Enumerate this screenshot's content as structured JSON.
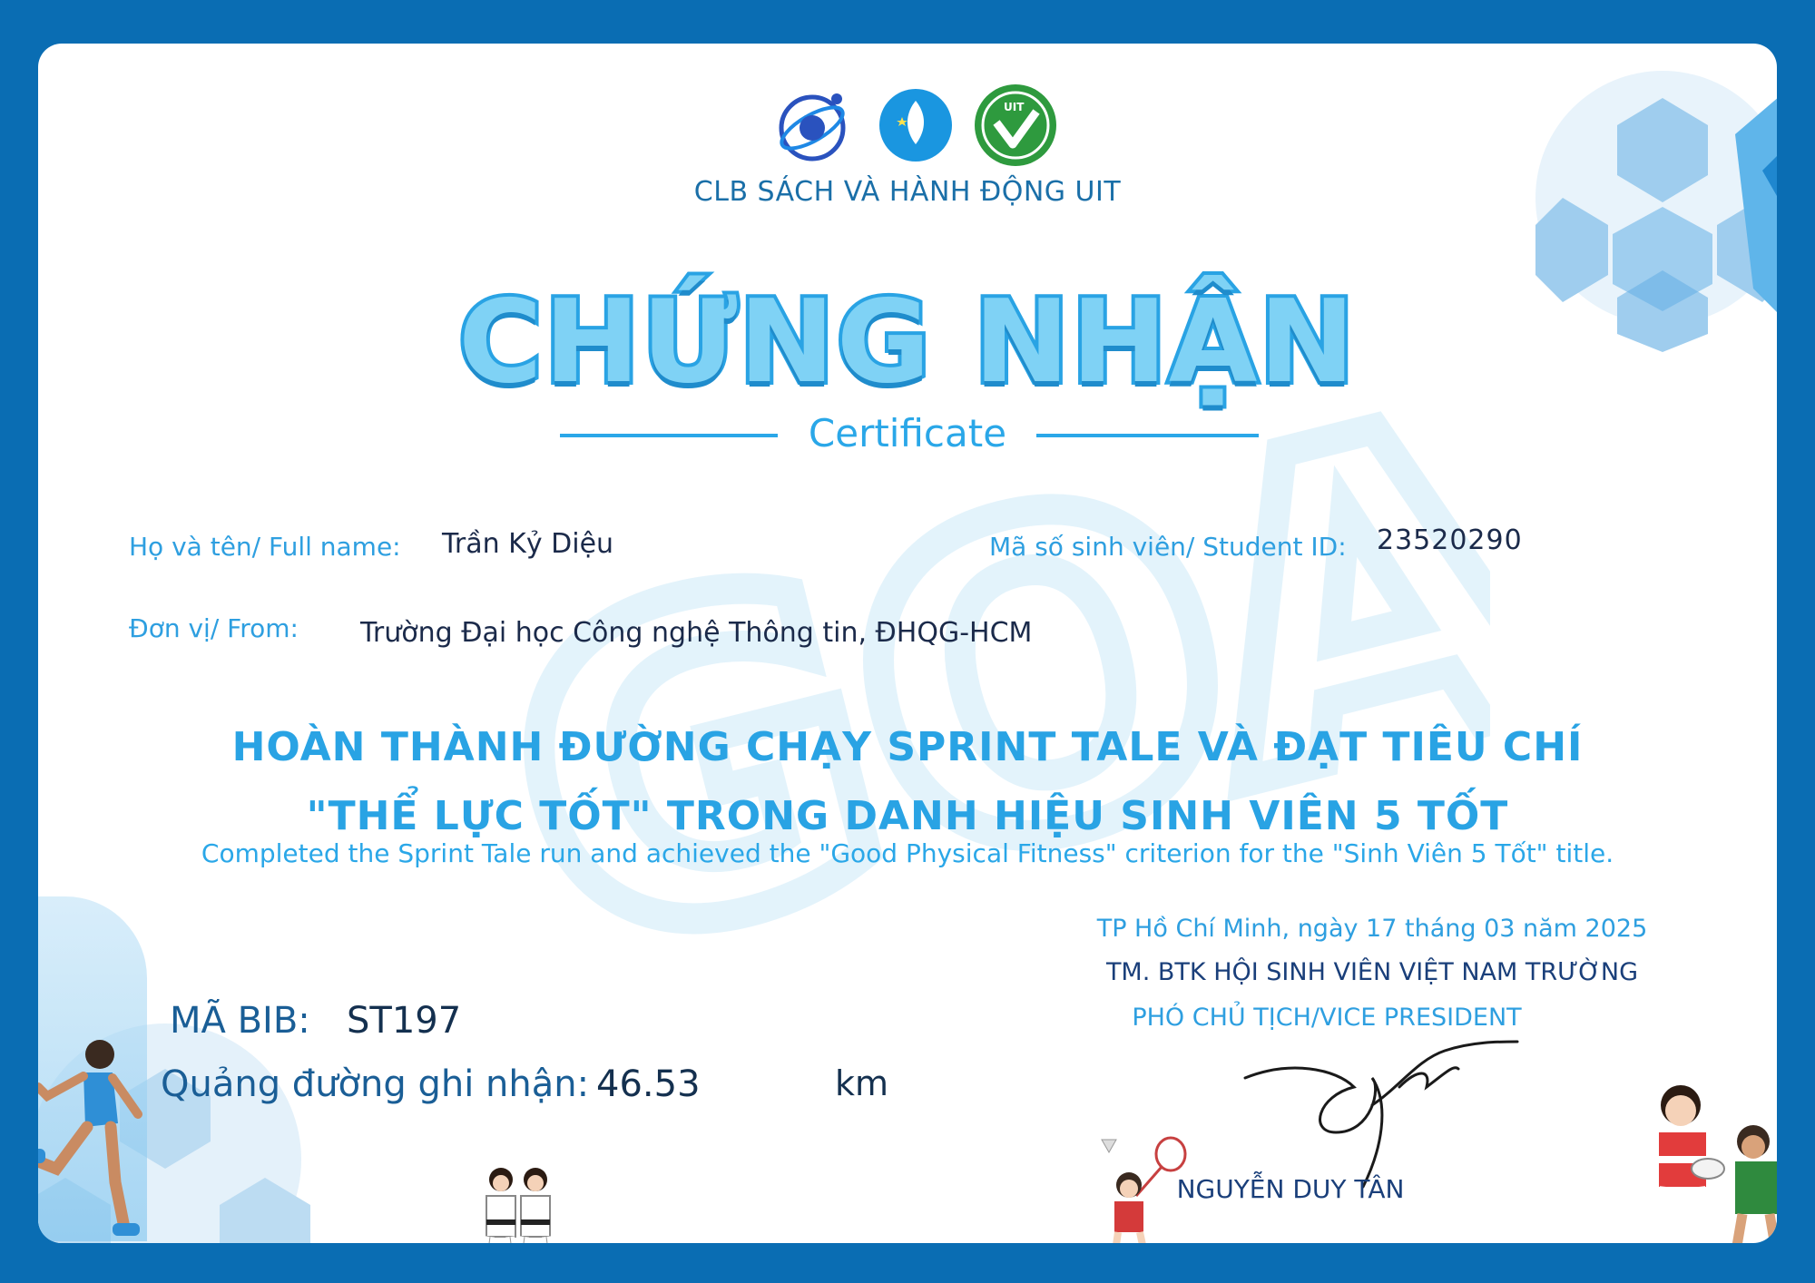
{
  "club": {
    "name": "CLB SÁCH VÀ HÀNH ĐỘNG UIT",
    "uit_badge_text": "UIT"
  },
  "certificate": {
    "title": "CHỨNG NHẬN",
    "subtitle": "Certificate"
  },
  "watermark": {
    "text": "GOAL!"
  },
  "recipient": {
    "name_label": "Họ và tên/ Full name:",
    "name": "Trần Kỷ Diệu",
    "id_label": "Mã số sinh viên/ Student ID:",
    "student_id": "23520290",
    "unit_label": "Đơn vị/ From:",
    "unit": "Trường Đại học Công nghệ Thông tin, ĐHQG-HCM"
  },
  "achievement": {
    "line1": "HOÀN THÀNH ĐƯỜNG CHẠY SPRINT TALE VÀ ĐẠT TIÊU CHÍ",
    "line2": "\"THỂ LỰC TỐT\" TRONG DANH HIỆU SINH VIÊN 5 TỐT",
    "english": "Completed the Sprint Tale run and achieved the \"Good Physical Fitness\" criterion for the \"Sinh Viên 5 Tốt\" title."
  },
  "signature": {
    "place_date": "TP Hồ Chí Minh, ngày 17 tháng 03 năm 2025",
    "org": "TM. BTK HỘI SINH VIÊN VIỆT NAM TRƯỜNG",
    "position": "PHÓ CHỦ TỊCH/VICE PRESIDENT",
    "signer": "NGUYỄN DUY TÂN"
  },
  "run": {
    "bib_label": "MÃ BIB:",
    "bib": "ST197",
    "distance_label": "Quảng đường ghi nhận:",
    "distance": "46.53",
    "unit": "km"
  },
  "colors": {
    "frame": "#0a6db3",
    "accent": "#2aa7e8",
    "title_fill": "#7fd2f5",
    "dark_text": "#1b2a4a"
  },
  "icons": [
    "uit-logo-icon",
    "youth-union-logo-icon",
    "uit-check-logo-icon",
    "soccer-ball-icon",
    "runner-icon",
    "judo-icon",
    "badminton-icon",
    "rugby-icon",
    "signature-icon"
  ]
}
